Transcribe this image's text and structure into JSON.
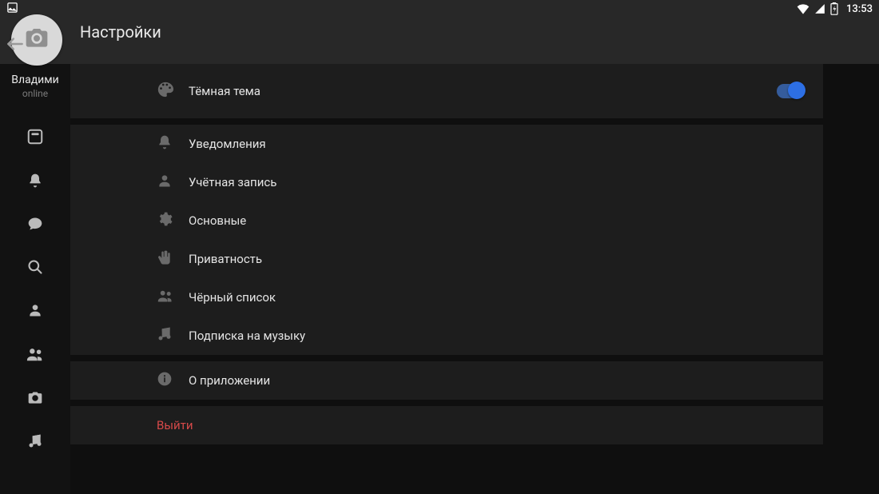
{
  "statusbar": {
    "time": "13:53"
  },
  "appbar": {
    "title": "Настройки"
  },
  "profile": {
    "name": "Владими",
    "status": "online"
  },
  "groups": {
    "theme": {
      "label": "Тёмная тема",
      "on": true
    },
    "notifications": "Уведомления",
    "account": "Учётная запись",
    "general": "Основные",
    "privacy": "Приватность",
    "blacklist": "Чёрный список",
    "music_sub": "Подписка на музыку",
    "about": "О приложении",
    "logout": "Выйти"
  }
}
